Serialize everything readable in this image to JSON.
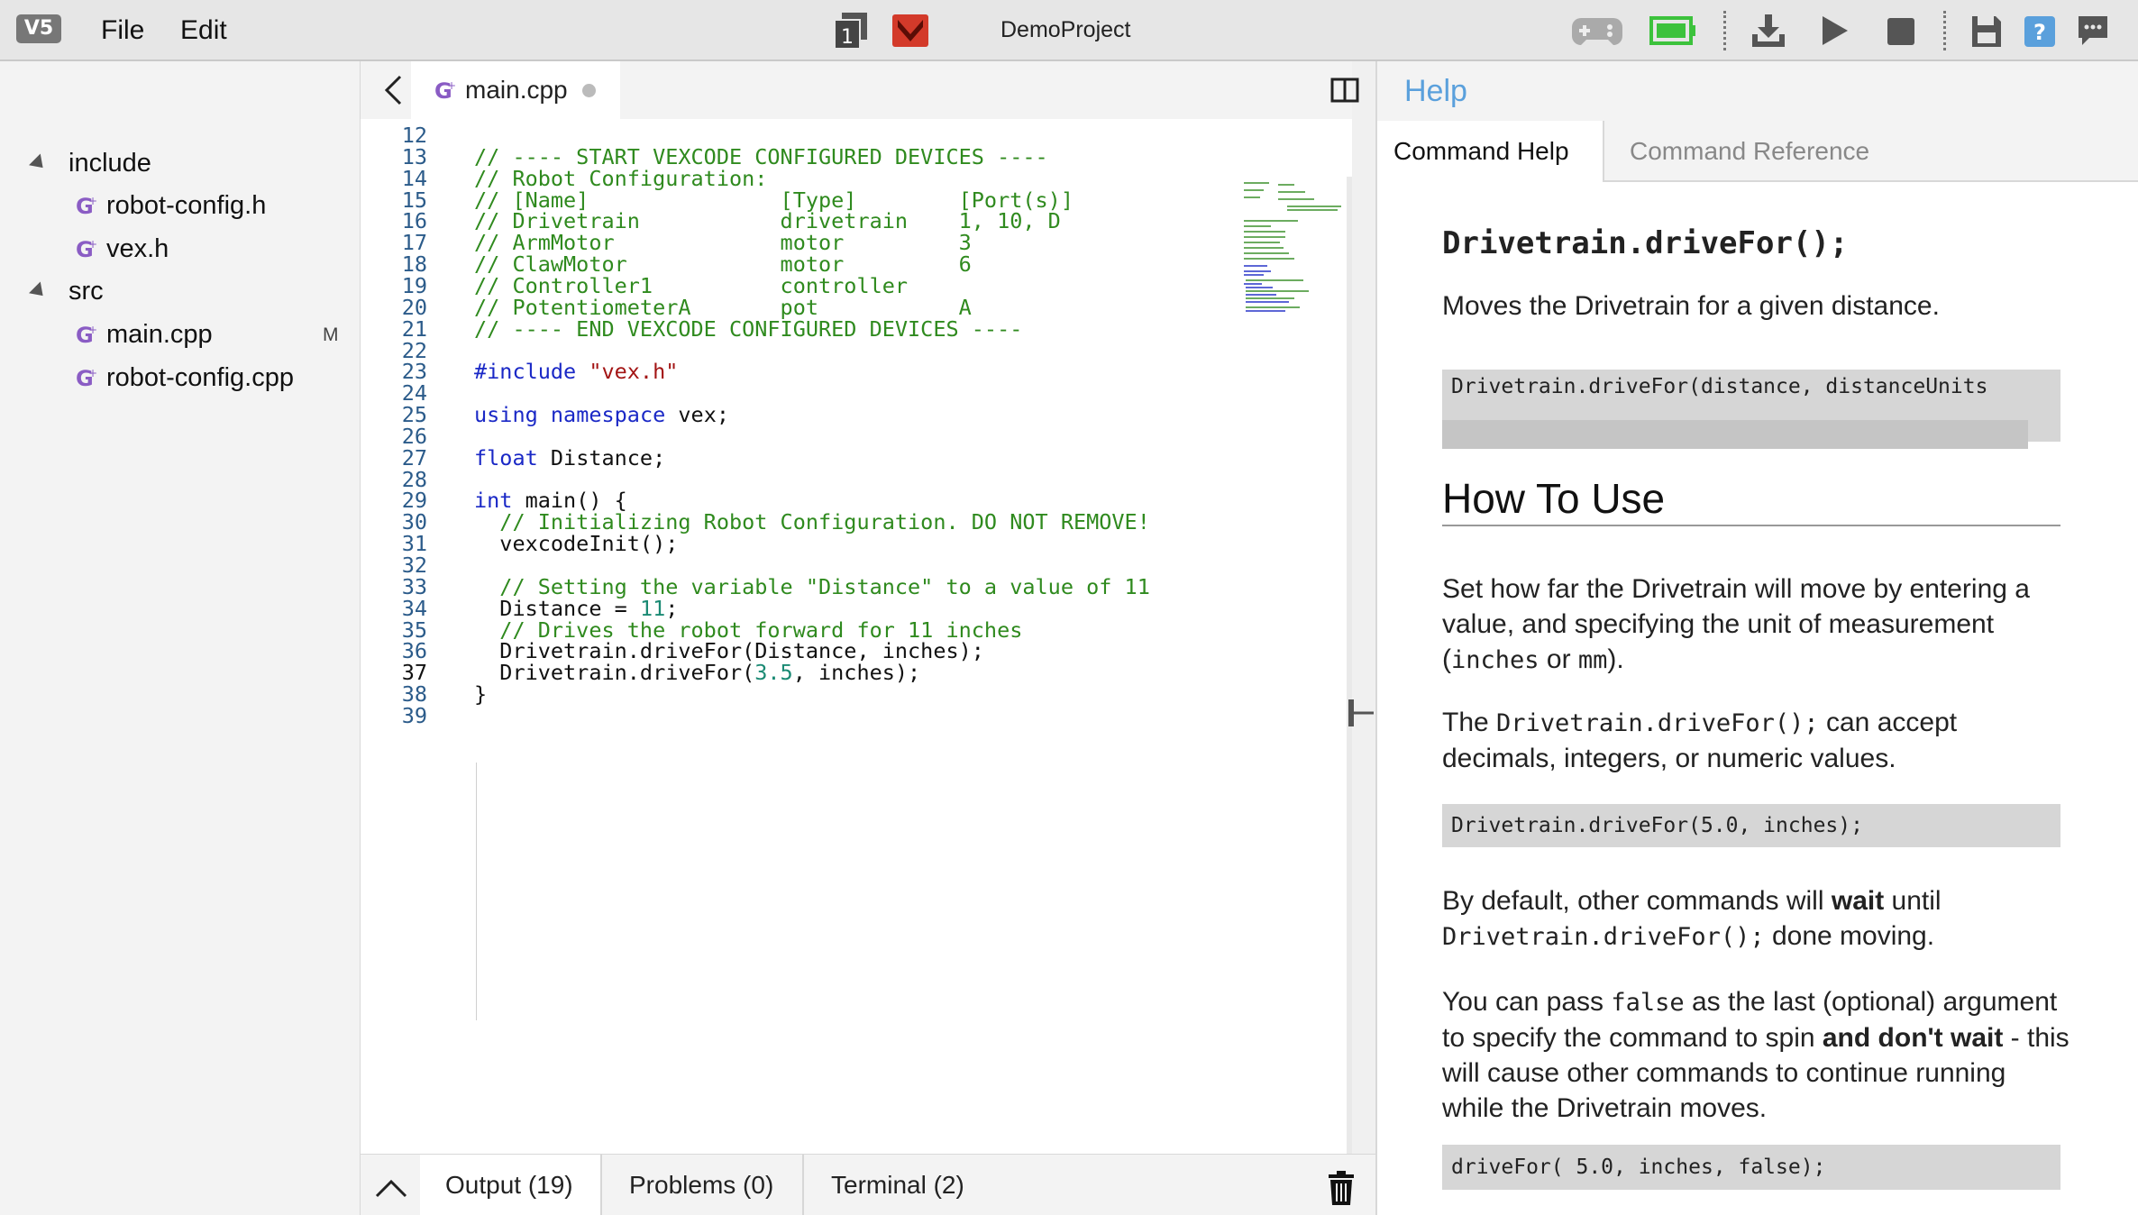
{
  "app": {
    "logo_text": "V5",
    "menu": {
      "file": "File",
      "edit": "Edit"
    },
    "project_title": "DemoProject",
    "slot_number": "1",
    "colors": {
      "accent": "#5aa0dc",
      "battery_green": "#3cc23c",
      "brain_red": "#d33a2a"
    }
  },
  "sidebar": {
    "items": [
      {
        "label": "include",
        "type": "folder"
      },
      {
        "label": "robot-config.h",
        "type": "file"
      },
      {
        "label": "vex.h",
        "type": "file"
      },
      {
        "label": "src",
        "type": "folder"
      },
      {
        "label": "main.cpp",
        "type": "file",
        "badge": "M"
      },
      {
        "label": "robot-config.cpp",
        "type": "file"
      }
    ]
  },
  "editor": {
    "tab_label": "main.cpp",
    "active_line": "37",
    "lines": [
      {
        "n": "12",
        "text": ""
      },
      {
        "n": "13",
        "text": "// ---- START VEXCODE CONFIGURED DEVICES ----"
      },
      {
        "n": "14",
        "text": "// Robot Configuration:"
      },
      {
        "n": "15",
        "text": "// [Name]               [Type]        [Port(s)]"
      },
      {
        "n": "16",
        "text": "// Drivetrain           drivetrain    1, 10, D"
      },
      {
        "n": "17",
        "text": "// ArmMotor             motor         3"
      },
      {
        "n": "18",
        "text": "// ClawMotor            motor         6"
      },
      {
        "n": "19",
        "text": "// Controller1          controller"
      },
      {
        "n": "20",
        "text": "// PotentiometerA       pot           A"
      },
      {
        "n": "21",
        "text": "// ---- END VEXCODE CONFIGURED DEVICES ----"
      },
      {
        "n": "22",
        "text": ""
      },
      {
        "n": "23",
        "text": "#include \"vex.h\""
      },
      {
        "n": "24",
        "text": ""
      },
      {
        "n": "25",
        "text": "using namespace vex;"
      },
      {
        "n": "26",
        "text": ""
      },
      {
        "n": "27",
        "text": "float Distance;"
      },
      {
        "n": "28",
        "text": ""
      },
      {
        "n": "29",
        "text": "int main() {"
      },
      {
        "n": "30",
        "text": "  // Initializing Robot Configuration. DO NOT REMOVE!"
      },
      {
        "n": "31",
        "text": "  vexcodeInit();"
      },
      {
        "n": "32",
        "text": ""
      },
      {
        "n": "33",
        "text": "  // Setting the variable \"Distance\" to a value of 11"
      },
      {
        "n": "34",
        "text": "  Distance = 11;"
      },
      {
        "n": "35",
        "text": "  // Drives the robot forward for 11 inches"
      },
      {
        "n": "36",
        "text": "  Drivetrain.driveFor(Distance, inches);"
      },
      {
        "n": "37",
        "text": "  Drivetrain.driveFor(3.5, inches);"
      },
      {
        "n": "38",
        "text": "}"
      },
      {
        "n": "39",
        "text": ""
      }
    ]
  },
  "bottom_panel": {
    "tabs": [
      {
        "label": "Output (19)"
      },
      {
        "label": "Problems (0)"
      },
      {
        "label": "Terminal (2)"
      }
    ]
  },
  "help": {
    "title": "Help",
    "tabs": [
      "Command Help",
      "Command Reference"
    ],
    "command": "Drivetrain.driveFor();",
    "summary": "Moves the Drivetrain for a given distance.",
    "signature": "Drivetrain.driveFor(distance, distanceUnits",
    "how_to_heading": "How To Use",
    "p1_a": "Set how far the Drivetrain will move by entering a value, and specifying the unit of measurement (",
    "p1_code1": "inches",
    "p1_b": " or ",
    "p1_code2": "mm",
    "p1_c": ").",
    "p2_a": "The ",
    "p2_code": "Drivetrain.driveFor();",
    "p2_b": " can accept decimals, integers, or numeric values.",
    "example1": "Drivetrain.driveFor(5.0, inches);",
    "p3_a": "By default, other commands will ",
    "p3_bold": "wait",
    "p3_b": " until ",
    "p3_code": "Drivetrain.driveFor();",
    "p3_c": " done moving.",
    "p4_a": "You can pass ",
    "p4_code": "false",
    "p4_b": " as the last (optional) argument to specify the command to spin ",
    "p4_bold": "and don't wait",
    "p4_c": " - this will cause other commands to continue running while the Drivetrain moves.",
    "example2": "driveFor( 5.0, inches, false);"
  }
}
